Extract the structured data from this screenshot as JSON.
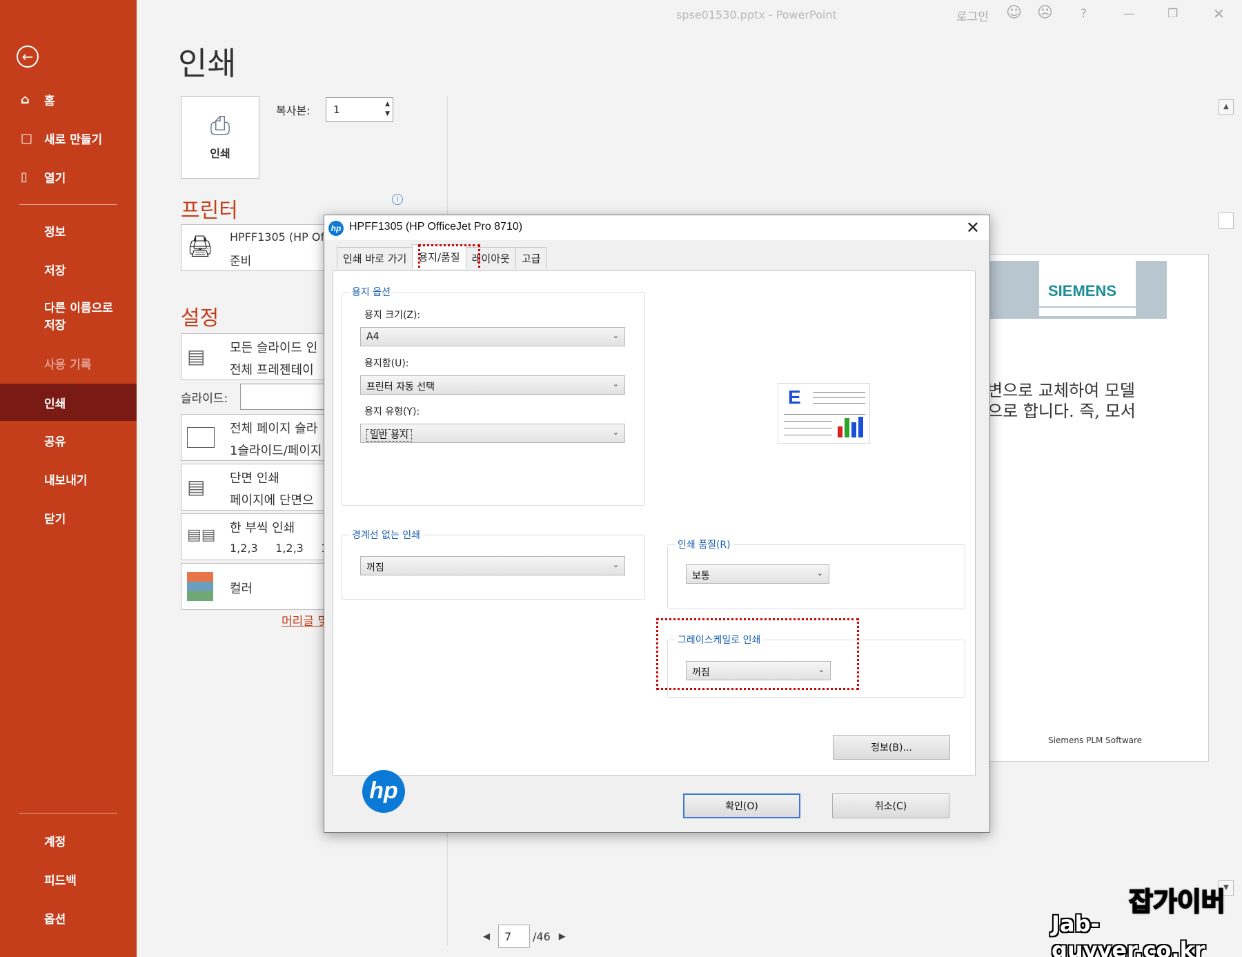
{
  "window": {
    "title": "spse01530.pptx  -  PowerPoint",
    "login": "로그인",
    "help": "?"
  },
  "sidebar": {
    "home": "홈",
    "new": "새로 만들기",
    "open": "열기",
    "info": "정보",
    "save": "저장",
    "save_as_line1": "다른 이름으로",
    "save_as_line2": "저장",
    "history": "사용 기록",
    "print": "인쇄",
    "share": "공유",
    "export": "내보내기",
    "close": "닫기",
    "account": "계정",
    "feedback": "피드백",
    "options": "옵션"
  },
  "print_page": {
    "title": "인쇄",
    "print_button": "인쇄",
    "copies_label": "복사본:",
    "copies_value": "1",
    "printer_section": "프린터",
    "printer_name": "HPFF1305 (HP Of",
    "printer_status": "준비",
    "settings_section": "설정",
    "setting_slides_line1": "모든 슬라이드 인",
    "setting_slides_line2": "전체 프레젠테이",
    "slides_label": "슬라이드:",
    "setting_layout_line1": "전체 페이지 슬라",
    "setting_layout_line2": "1슬라이드/페이지",
    "setting_sides_line1": "단면 인쇄",
    "setting_sides_line2": "페이지에 단면으",
    "setting_collate_line1": "한 부씩 인쇄",
    "setting_collate_line2": "1,2,3     1,2,3     1",
    "setting_color": "컬러",
    "header_link": "머리글 및"
  },
  "preview": {
    "siemens": "SIEMENS",
    "text_line1": "변으로 교체하여 모델",
    "text_line2": "으로 합니다. 즉, 모서",
    "footer": "Siemens PLM Software",
    "page_current": "7",
    "page_total": "/46"
  },
  "dialog": {
    "title": "HPFF1305 (HP OfficeJet Pro 8710)",
    "close": "✕",
    "tabs": [
      "인쇄 바로 가기",
      "용지/품질",
      "레이아웃",
      "고급"
    ],
    "paper_options_title": "용지 옵션",
    "paper_size_label": "용지 크기(Z):",
    "paper_size_value": "A4",
    "paper_source_label": "용지함(U):",
    "paper_source_value": "프린터 자동 선택",
    "paper_type_label": "용지 유형(Y):",
    "paper_type_value": "일반 용지",
    "borderless_title": "경계선 없는 인쇄",
    "borderless_value": "꺼짐",
    "quality_title": "인쇄 품질(R)",
    "quality_value": "보통",
    "grayscale_title": "그레이스케일로 인쇄",
    "grayscale_value": "꺼짐",
    "illustration_letter": "E",
    "about_button": "정보(B)...",
    "ok_button": "확인(O)",
    "cancel_button": "취소(C)",
    "hp_logo": "hp"
  },
  "watermark": {
    "line1": "잡가이버",
    "line2": "Jab-guyver.co.kr"
  },
  "colors": {
    "accent": "#c43e1c",
    "sidebar_active": "#7a1a14",
    "highlight": "#d40000",
    "hp_blue": "#0a7ad6"
  }
}
